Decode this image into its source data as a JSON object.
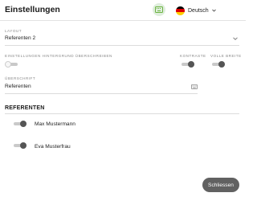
{
  "header": {
    "title": "Einstellungen",
    "language": "Deutsch",
    "flag_colors": [
      "#000000",
      "#dd0000",
      "#ffce00"
    ]
  },
  "layout": {
    "label": "Layout",
    "value": "Referenten 2"
  },
  "toggles": {
    "override_bg_label": "Einstellungen Hintergrund überschreiben",
    "override_bg_state": "off",
    "contrast_label": "Kontraste",
    "contrast_state": "on",
    "full_width_label": "Volle Breite",
    "full_width_state": "on"
  },
  "heading_field": {
    "label": "Überschrift",
    "value": "Referenten"
  },
  "speakers": {
    "section_title": "REFERENTEN",
    "items": [
      {
        "name": "Max Mustermann",
        "state": "on"
      },
      {
        "name": "Eva Musterfrau",
        "state": "on"
      }
    ]
  },
  "footer": {
    "close_label": "Schliessen"
  },
  "colors": {
    "accent_green_bg": "#dfeedd",
    "accent_green": "#6cb33f",
    "button_dark": "#616161",
    "toggle_on": "#555555"
  }
}
